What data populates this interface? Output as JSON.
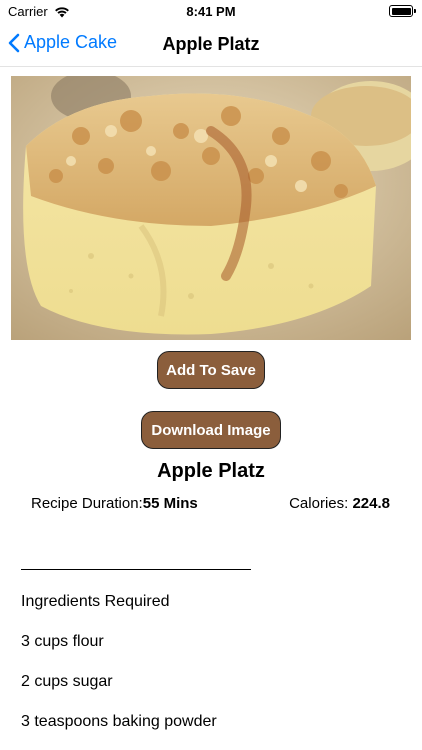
{
  "status_bar": {
    "carrier": "Carrier",
    "time": "8:41 PM",
    "wifi_icon": "wifi-icon",
    "battery_icon": "battery-icon"
  },
  "nav": {
    "back_label": "Apple Cake",
    "back_icon": "chevron-left-icon",
    "title": "Apple Platz"
  },
  "image": {
    "description_icon": "recipe-photo"
  },
  "buttons": {
    "save_label": "Add To Save",
    "download_label": "Download Image"
  },
  "recipe": {
    "title": "Apple Platz",
    "duration_label": "Recipe Duration:",
    "duration_value": "55 Mins",
    "calories_label": "Calories: ",
    "calories_value": "224.8"
  },
  "ingredients": {
    "header": "Ingredients Required",
    "items": [
      "3 cups flour",
      "2 cups sugar",
      "3 teaspoons baking powder"
    ]
  },
  "colors": {
    "accent": "#007aff",
    "button_bg": "#8b5e3c"
  }
}
